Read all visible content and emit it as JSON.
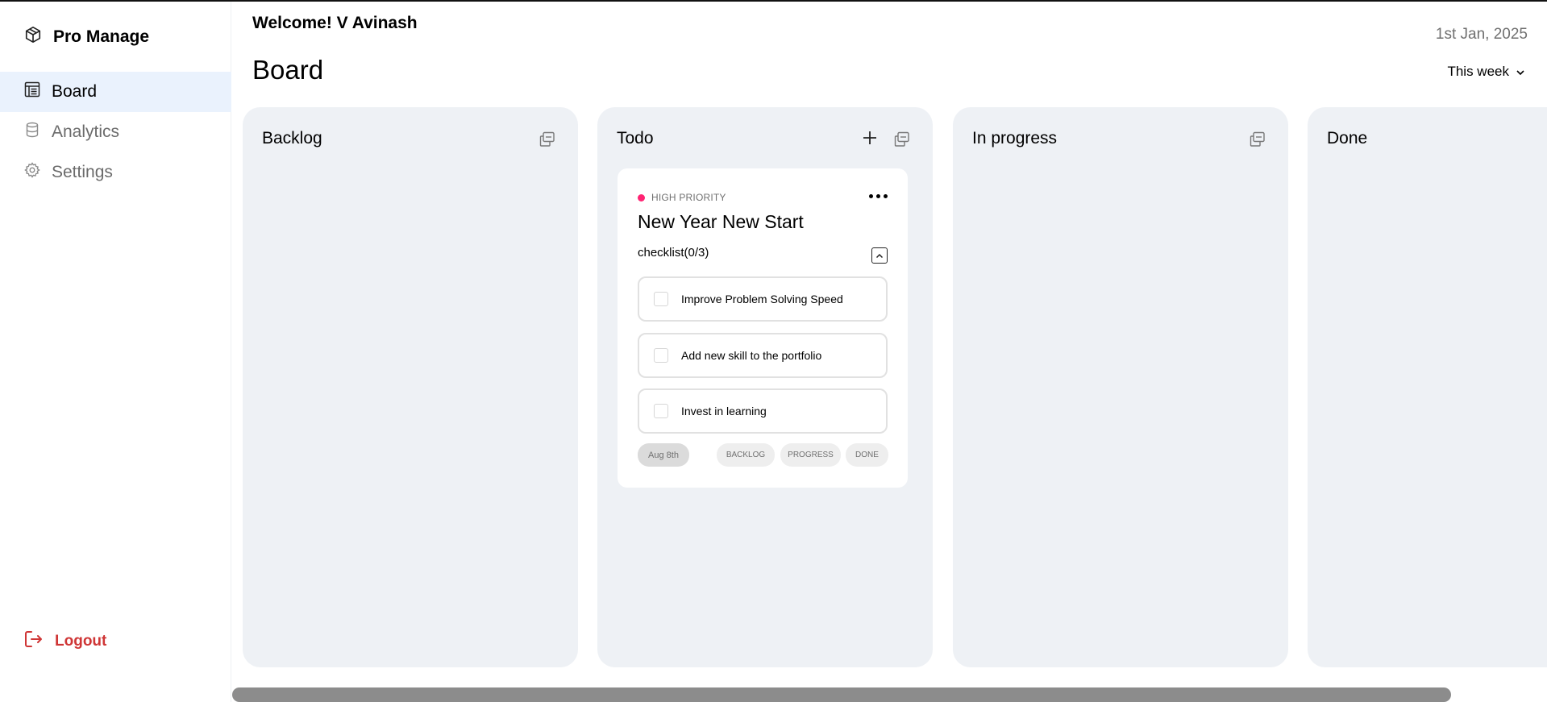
{
  "app": {
    "name": "Pro Manage"
  },
  "sidebar": {
    "items": [
      {
        "label": "Board",
        "icon": "board-icon",
        "active": true
      },
      {
        "label": "Analytics",
        "icon": "database-icon",
        "active": false
      },
      {
        "label": "Settings",
        "icon": "gear-icon",
        "active": false
      }
    ],
    "logout_label": "Logout"
  },
  "header": {
    "welcome": "Welcome! V Avinash",
    "date": "1st Jan, 2025",
    "title": "Board",
    "period": "This week"
  },
  "columns": [
    {
      "title": "Backlog"
    },
    {
      "title": "Todo"
    },
    {
      "title": "In progress"
    },
    {
      "title": "Done"
    }
  ],
  "card": {
    "priority": "HIGH PRIORITY",
    "priority_color": "#ff2473",
    "title": "New Year New Start",
    "checklist_label": "checklist(0/3)",
    "checklist_checked": 0,
    "checklist_total": 3,
    "tasks": [
      {
        "text": "Improve Problem Solving Speed",
        "checked": false
      },
      {
        "text": "Add new skill to the portfolio",
        "checked": false
      },
      {
        "text": "Invest in learning",
        "checked": false
      }
    ],
    "due_date": "Aug 8th",
    "moves": [
      "BACKLOG",
      "PROGRESS",
      "DONE"
    ]
  },
  "colors": {
    "accent_active": "#eaf2fd",
    "logout": "#cf3636",
    "column_bg": "#eef1f5"
  }
}
